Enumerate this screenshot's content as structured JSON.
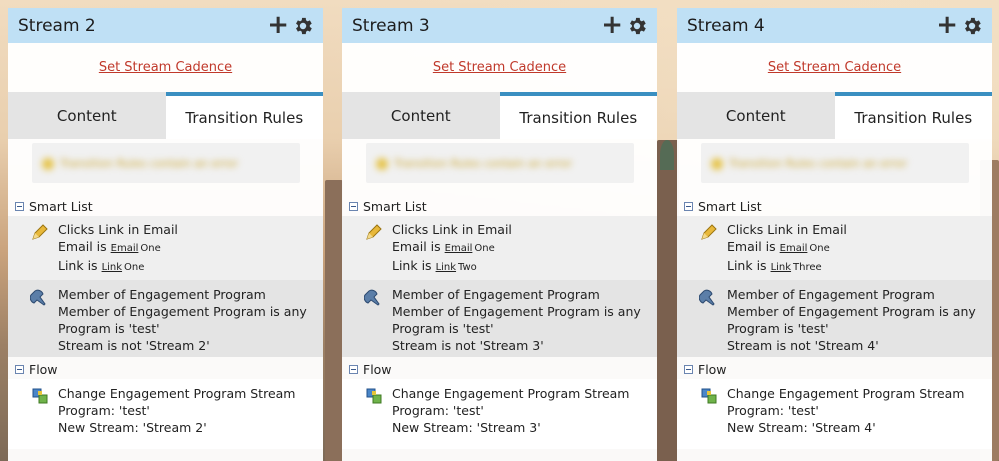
{
  "panels": [
    {
      "title": "Stream 2",
      "cadence_link": "Set Stream Cadence",
      "tabs": {
        "content": "Content",
        "transition_rules": "Transition Rules"
      },
      "warning": "Transition Rules contain an error",
      "smart_list": {
        "header": "Smart List",
        "clicks": {
          "title": "Clicks Link in Email",
          "email_prefix": "Email is",
          "email_u": "Email",
          "email_rest": "One",
          "link_prefix": "Link is",
          "link_u": "Link",
          "link_rest": "One"
        },
        "member": {
          "title": "Member of Engagement Program",
          "line1": "Member of Engagement Program is any",
          "line2": "Program is 'test'",
          "line3": "Stream is not 'Stream 2'"
        }
      },
      "flow": {
        "header": "Flow",
        "change": {
          "title": "Change Engagement Program Stream",
          "line1": "Program: 'test'",
          "line2": "New Stream: 'Stream 2'"
        }
      }
    },
    {
      "title": "Stream 3",
      "cadence_link": "Set Stream Cadence",
      "tabs": {
        "content": "Content",
        "transition_rules": "Transition Rules"
      },
      "warning": "Transition Rules contain an error",
      "smart_list": {
        "header": "Smart List",
        "clicks": {
          "title": "Clicks Link in Email",
          "email_prefix": "Email is",
          "email_u": "Email",
          "email_rest": "One",
          "link_prefix": "Link is",
          "link_u": "Link",
          "link_rest": "Two"
        },
        "member": {
          "title": "Member of Engagement Program",
          "line1": "Member of Engagement Program is any",
          "line2": "Program is 'test'",
          "line3": "Stream is not 'Stream 3'"
        }
      },
      "flow": {
        "header": "Flow",
        "change": {
          "title": "Change Engagement Program Stream",
          "line1": "Program: 'test'",
          "line2": "New Stream: 'Stream 3'"
        }
      }
    },
    {
      "title": "Stream 4",
      "cadence_link": "Set Stream Cadence",
      "tabs": {
        "content": "Content",
        "transition_rules": "Transition Rules"
      },
      "warning": "Transition Rules contain an error",
      "smart_list": {
        "header": "Smart List",
        "clicks": {
          "title": "Clicks Link in Email",
          "email_prefix": "Email is",
          "email_u": "Email",
          "email_rest": "One",
          "link_prefix": "Link is",
          "link_u": "Link",
          "link_rest": "Three"
        },
        "member": {
          "title": "Member of Engagement Program",
          "line1": "Member of Engagement Program is any",
          "line2": "Program is 'test'",
          "line3": "Stream is not 'Stream 4'"
        }
      },
      "flow": {
        "header": "Flow",
        "change": {
          "title": "Change Engagement Program Stream",
          "line1": "Program: 'test'",
          "line2": "New Stream: 'Stream 4'"
        }
      }
    }
  ],
  "icons": {
    "add": "plus-icon",
    "settings": "gear-icon",
    "collapse": "collapse-icon",
    "clicks_link": "pencil-icon",
    "member": "pushpin-icon",
    "change_stream": "stream-change-icon"
  },
  "colors": {
    "header_bg": "#bfe0f5",
    "active_tab_border": "#3a8fc1",
    "link": "#c0392b"
  }
}
